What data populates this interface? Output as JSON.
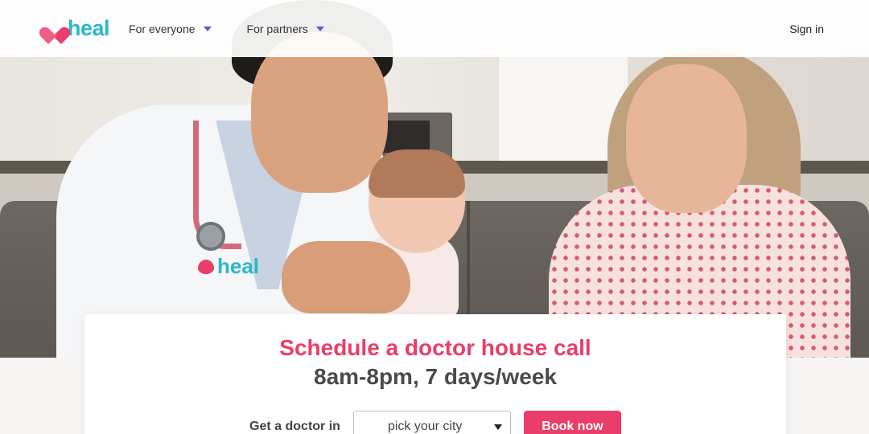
{
  "header": {
    "logo_text": "heal",
    "nav": [
      {
        "label": "For everyone"
      },
      {
        "label": "For partners"
      }
    ],
    "signin_label": "Sign in"
  },
  "hero": {
    "coat_logo_text": "heal",
    "image_description_icon": "photo"
  },
  "card": {
    "headline": "Schedule a doctor house call",
    "subhead": "8am-8pm, 7 days/week",
    "cta_label": "Get a doctor in",
    "city_select_value": "pick your city",
    "book_button_label": "Book now"
  },
  "colors": {
    "brand_pink": "#ea3e6a",
    "brand_teal": "#2ab7c9",
    "nav_caret": "#6a4fd6"
  }
}
